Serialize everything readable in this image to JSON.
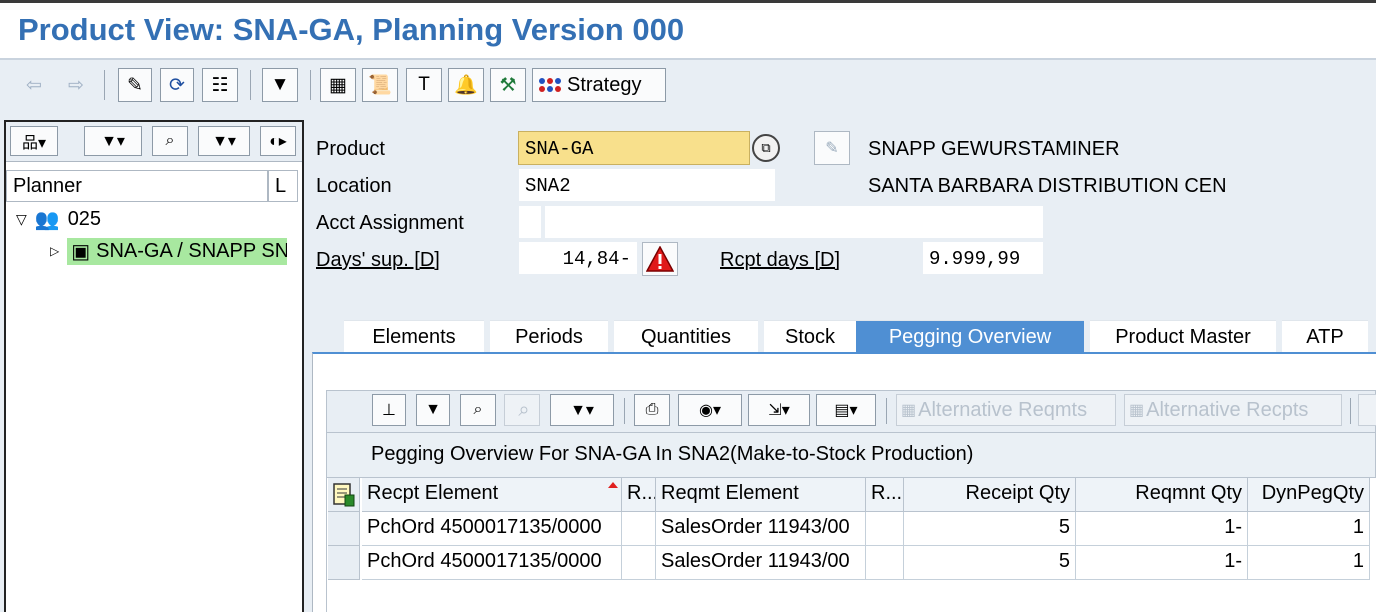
{
  "title": "Product View: SNA-GA, Planning Version 000",
  "main_toolbar": {
    "strategy_label": "Strategy"
  },
  "left_panel": {
    "column_header": "Planner",
    "column_header_short": "L",
    "tree": {
      "root_label": "025",
      "child_label": "SNA-GA / SNAPP SN"
    }
  },
  "header_fields": {
    "product_label": "Product",
    "product_value": "SNA-GA",
    "product_desc": "SNAPP GEWURSTAMINER",
    "location_label": "Location",
    "location_value": "SNA2",
    "location_desc": "SANTA BARBARA DISTRIBUTION CEN",
    "acct_label": "Acct Assignment",
    "days_sup_label": "Days' sup. [D]",
    "days_sup_value": "14,84-",
    "rcpt_days_label": "Rcpt days [D]",
    "rcpt_days_value": "9.999,99"
  },
  "tabs": [
    {
      "label": "Elements"
    },
    {
      "label": "Periods"
    },
    {
      "label": "Quantities"
    },
    {
      "label": "Stock"
    },
    {
      "label": "Pegging Overview",
      "active": true
    },
    {
      "label": "Product Master"
    },
    {
      "label": "ATP"
    }
  ],
  "alv_toolbar": {
    "alt_reqmts_label": "Alternative Reqmts",
    "alt_recpts_label": "Alternative Recpts"
  },
  "grid": {
    "title": "Pegging Overview For SNA-GA In SNA2(Make-to-Stock Production)",
    "columns": [
      "Recpt Element",
      "R...",
      "Reqmt Element",
      "R...",
      "Receipt Qty",
      "Reqmnt Qty",
      "DynPegQty"
    ],
    "rows": [
      [
        "PchOrd 4500017135/0000",
        "",
        "SalesOrder 11943/00",
        "",
        "5",
        "1-",
        "1"
      ],
      [
        "PchOrd 4500017135/0000",
        "",
        "SalesOrder 11943/00",
        "",
        "5",
        "1-",
        "1"
      ]
    ]
  },
  "colors": {
    "title_blue": "#3470b4",
    "tab_active": "#4f8fd3",
    "product_highlight": "#f8e08c",
    "tree_highlight": "#a8e8a0",
    "panel_bg": "#e8eef4"
  }
}
